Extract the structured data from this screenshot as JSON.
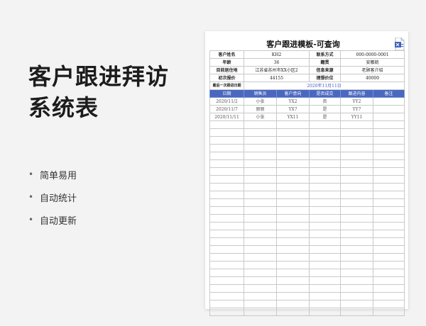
{
  "page": {
    "title": "客户跟进拜访系统表",
    "features": [
      "简单易用",
      "自动统计",
      "自动更新"
    ]
  },
  "sheet": {
    "title": "客户跟进模板-可查询",
    "info_rows": [
      [
        "客户姓名",
        "KH2",
        "联系方式",
        "000-0000-0001"
      ],
      [
        "年龄",
        "36",
        "籍贯",
        "安徽皖"
      ],
      [
        "目前居住地",
        "江苏省苏州市XX小区2",
        "信息来源",
        "老顾客介绍"
      ],
      [
        "初次报价",
        "44155",
        "理想价位",
        "40000"
      ]
    ],
    "last_visit": {
      "label": "最后一次跟进日期",
      "value": "2020年11月11日"
    },
    "headers": [
      "日期",
      "销售员",
      "客户意向",
      "是否成交",
      "跟进内容",
      "备注"
    ],
    "records": [
      [
        "2020/11/2",
        "小张",
        "YX2",
        "否",
        "YY2",
        ""
      ],
      [
        "2020/11/7",
        "丽丽",
        "YX7",
        "是",
        "YY7",
        ""
      ],
      [
        "2020/11/11",
        "小张",
        "YX11",
        "是",
        "YY11",
        ""
      ]
    ]
  },
  "colors": {
    "header_bg": "#4a68c0",
    "accent_text": "#4a60c4"
  },
  "icons": {
    "sheet_icon": "spreadsheet-file-icon"
  }
}
